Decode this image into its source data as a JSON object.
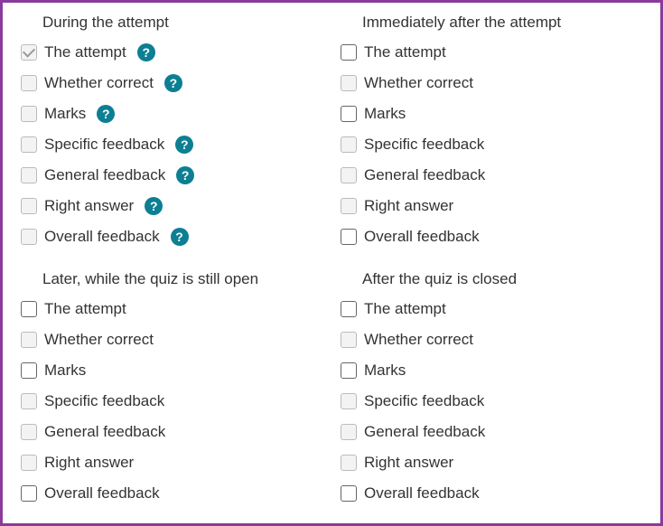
{
  "sections": [
    {
      "title": "During the attempt",
      "options": [
        {
          "label": "The attempt",
          "checked": true,
          "disabled": true,
          "help": true
        },
        {
          "label": "Whether correct",
          "checked": false,
          "disabled": true,
          "help": true
        },
        {
          "label": "Marks",
          "checked": false,
          "disabled": true,
          "help": true
        },
        {
          "label": "Specific feedback",
          "checked": false,
          "disabled": true,
          "help": true
        },
        {
          "label": "General feedback",
          "checked": false,
          "disabled": true,
          "help": true
        },
        {
          "label": "Right answer",
          "checked": false,
          "disabled": true,
          "help": true
        },
        {
          "label": "Overall feedback",
          "checked": false,
          "disabled": true,
          "help": true
        }
      ]
    },
    {
      "title": "Immediately after the attempt",
      "options": [
        {
          "label": "The attempt",
          "checked": false,
          "disabled": false,
          "help": false
        },
        {
          "label": "Whether correct",
          "checked": false,
          "disabled": true,
          "help": false
        },
        {
          "label": "Marks",
          "checked": false,
          "disabled": false,
          "help": false
        },
        {
          "label": "Specific feedback",
          "checked": false,
          "disabled": true,
          "help": false
        },
        {
          "label": "General feedback",
          "checked": false,
          "disabled": true,
          "help": false
        },
        {
          "label": "Right answer",
          "checked": false,
          "disabled": true,
          "help": false
        },
        {
          "label": "Overall feedback",
          "checked": false,
          "disabled": false,
          "help": false
        }
      ]
    },
    {
      "title": "Later, while the quiz is still open",
      "options": [
        {
          "label": "The attempt",
          "checked": false,
          "disabled": false,
          "help": false
        },
        {
          "label": "Whether correct",
          "checked": false,
          "disabled": true,
          "help": false
        },
        {
          "label": "Marks",
          "checked": false,
          "disabled": false,
          "help": false
        },
        {
          "label": "Specific feedback",
          "checked": false,
          "disabled": true,
          "help": false
        },
        {
          "label": "General feedback",
          "checked": false,
          "disabled": true,
          "help": false
        },
        {
          "label": "Right answer",
          "checked": false,
          "disabled": true,
          "help": false
        },
        {
          "label": "Overall feedback",
          "checked": false,
          "disabled": false,
          "help": false
        }
      ]
    },
    {
      "title": "After the quiz is closed",
      "options": [
        {
          "label": "The attempt",
          "checked": false,
          "disabled": false,
          "help": false
        },
        {
          "label": "Whether correct",
          "checked": false,
          "disabled": true,
          "help": false
        },
        {
          "label": "Marks",
          "checked": false,
          "disabled": false,
          "help": false
        },
        {
          "label": "Specific feedback",
          "checked": false,
          "disabled": true,
          "help": false
        },
        {
          "label": "General feedback",
          "checked": false,
          "disabled": true,
          "help": false
        },
        {
          "label": "Right answer",
          "checked": false,
          "disabled": true,
          "help": false
        },
        {
          "label": "Overall feedback",
          "checked": false,
          "disabled": false,
          "help": false
        }
      ]
    }
  ]
}
